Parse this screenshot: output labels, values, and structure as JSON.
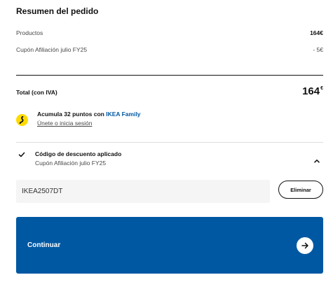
{
  "summary": {
    "title": "Resumen del pedido",
    "products_label": "Productos",
    "products_amount": "164€",
    "coupon_label": "Cupón Afiliación julio FY25",
    "coupon_amount": "- 5€"
  },
  "total": {
    "label": "Total (con IVA)",
    "amount": "164",
    "currency": "€"
  },
  "family": {
    "icon": "ikea-family-icon",
    "prefix": "Acumula 32 puntos con ",
    "brand": "IKEA Family",
    "link": "Únete o inicia sesión",
    "icon_color": "#ffdb00",
    "brand_color": "#0058a3"
  },
  "discount": {
    "title": "Código de descuento aplicado",
    "subtitle": "Cupón Afiliación julio FY25",
    "code_value": "IKEA2507DT",
    "remove_label": "Eliminar",
    "expanded": true
  },
  "continue": {
    "label": "Continuar",
    "background": "#0058a3"
  }
}
